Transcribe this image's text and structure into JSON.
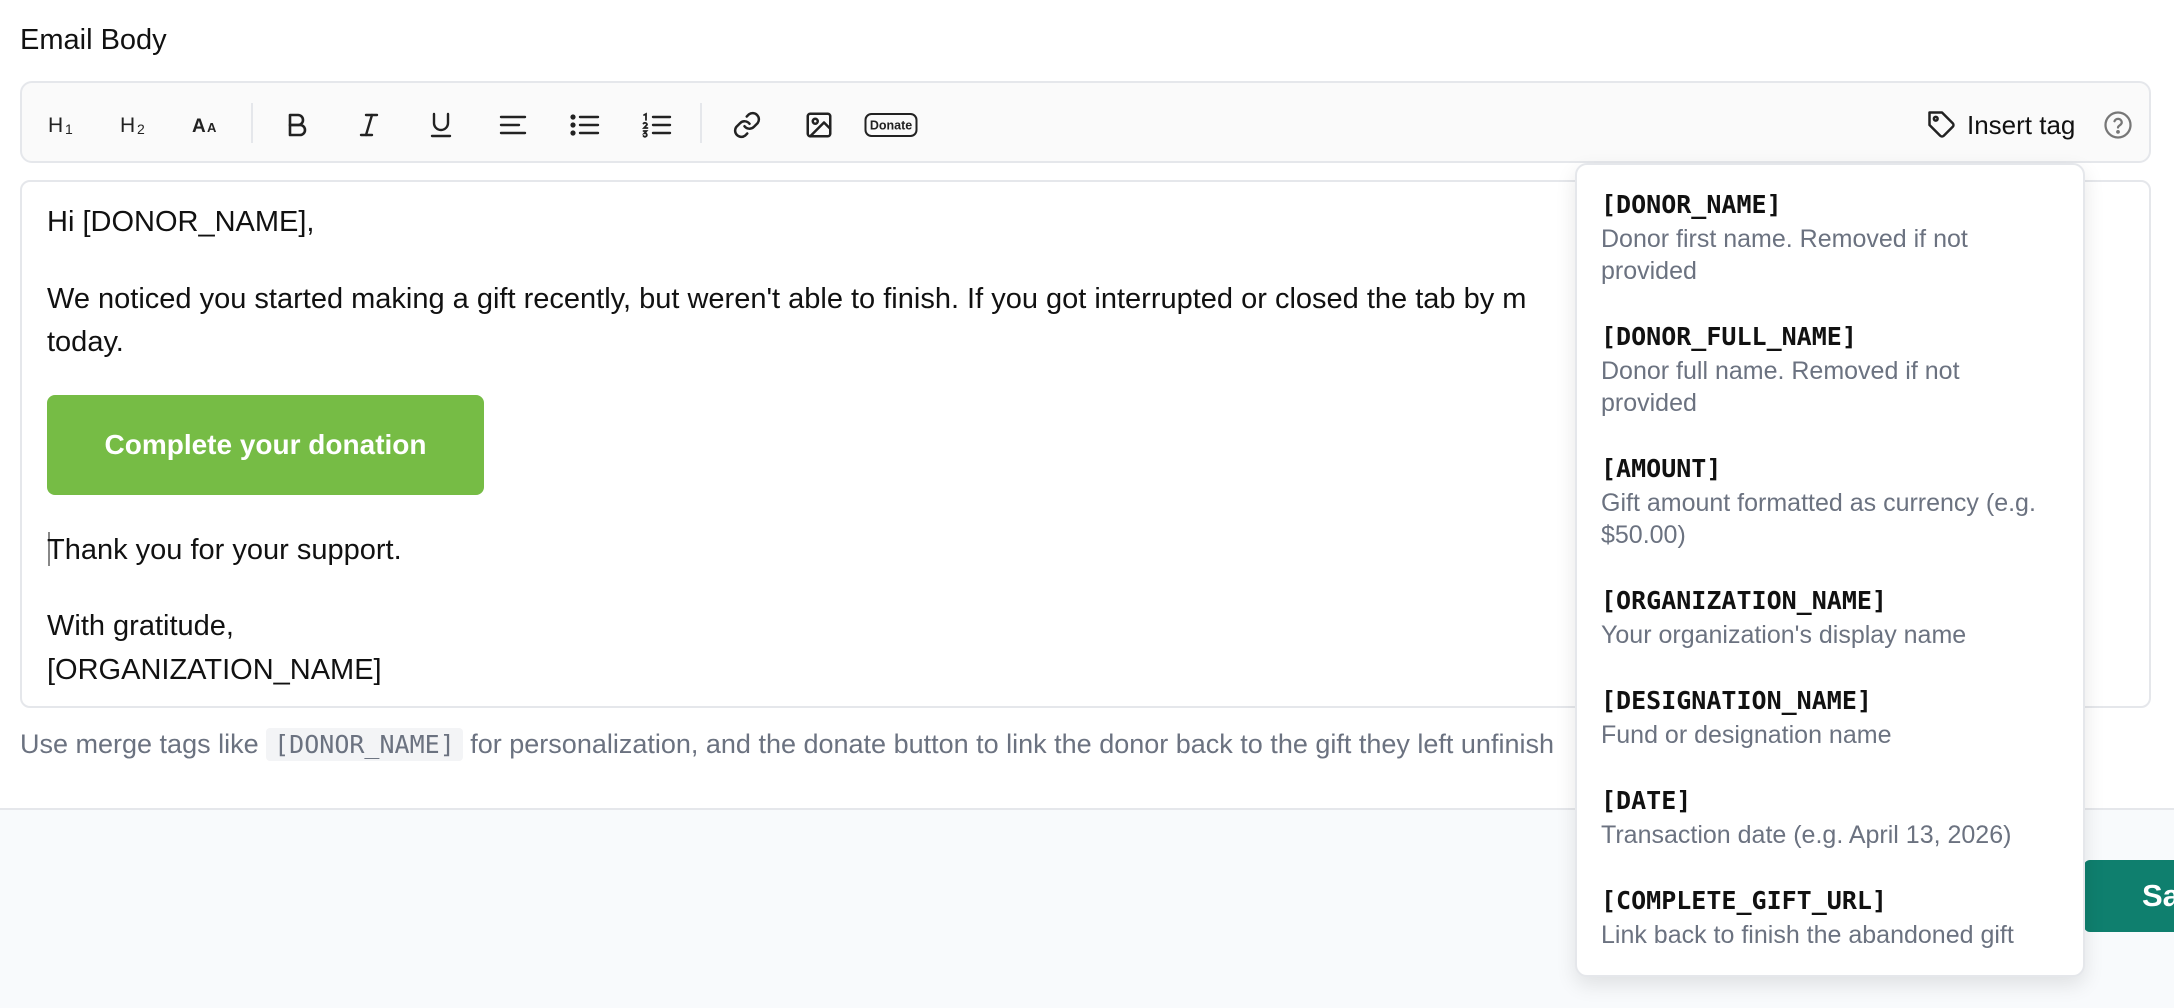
{
  "section_label": "Email Body",
  "toolbar": {
    "buttons": [
      {
        "name": "heading-1",
        "icon": "h1-icon"
      },
      {
        "name": "heading-2",
        "icon": "h2-icon"
      },
      {
        "name": "font-size",
        "icon": "font-size-icon"
      },
      {
        "name": "bold",
        "icon": "bold-icon"
      },
      {
        "name": "italic",
        "icon": "italic-icon"
      },
      {
        "name": "underline",
        "icon": "underline-icon"
      },
      {
        "name": "align-left",
        "icon": "align-left-icon"
      },
      {
        "name": "bullet-list",
        "icon": "bullet-list-icon"
      },
      {
        "name": "numbered-list",
        "icon": "numbered-list-icon"
      },
      {
        "name": "link",
        "icon": "link-icon"
      },
      {
        "name": "image",
        "icon": "image-icon"
      },
      {
        "name": "donate-button",
        "icon": "donate-icon"
      }
    ],
    "donate_label": "Donate",
    "insert_tag_label": "Insert tag"
  },
  "editor": {
    "greeting": "Hi [DONOR_NAME],",
    "paragraph_line1": "We noticed you started making a gift recently, but weren't able to finish. If you got interrupted or closed the tab by m",
    "paragraph_line2": "today.",
    "cta_label": "Complete your donation",
    "thanks": "Thank you for your support.",
    "signoff": "With gratitude,",
    "org_tag": "[ORGANIZATION_NAME]"
  },
  "help": {
    "prefix": "Use merge tags like",
    "code": "[DONOR_NAME]",
    "suffix": "for personalization, and the donate button to link the donor back to the gift they left unfinish"
  },
  "save_label": "Save",
  "tags": [
    {
      "name": "[DONOR_NAME]",
      "desc_line1": "Donor first name. Removed if not",
      "desc_line2": "provided"
    },
    {
      "name": "[DONOR_FULL_NAME]",
      "desc_line1": "Donor full name. Removed if not",
      "desc_line2": "provided"
    },
    {
      "name": "[AMOUNT]",
      "desc_line1": "Gift amount formatted as currency (e.g.",
      "desc_line2": "$50.00)"
    },
    {
      "name": "[ORGANIZATION_NAME]",
      "desc_line1": "Your organization's display name",
      "desc_line2": ""
    },
    {
      "name": "[DESIGNATION_NAME]",
      "desc_line1": "Fund or designation name",
      "desc_line2": ""
    },
    {
      "name": "[DATE]",
      "desc_line1": "Transaction date (e.g. April 13, 2026)",
      "desc_line2": ""
    },
    {
      "name": "[COMPLETE_GIFT_URL]",
      "desc_line1": "Link back to finish the abandoned gift",
      "desc_line2": ""
    }
  ],
  "colors": {
    "cta": "#76bc45",
    "save": "#0f7f6e"
  }
}
